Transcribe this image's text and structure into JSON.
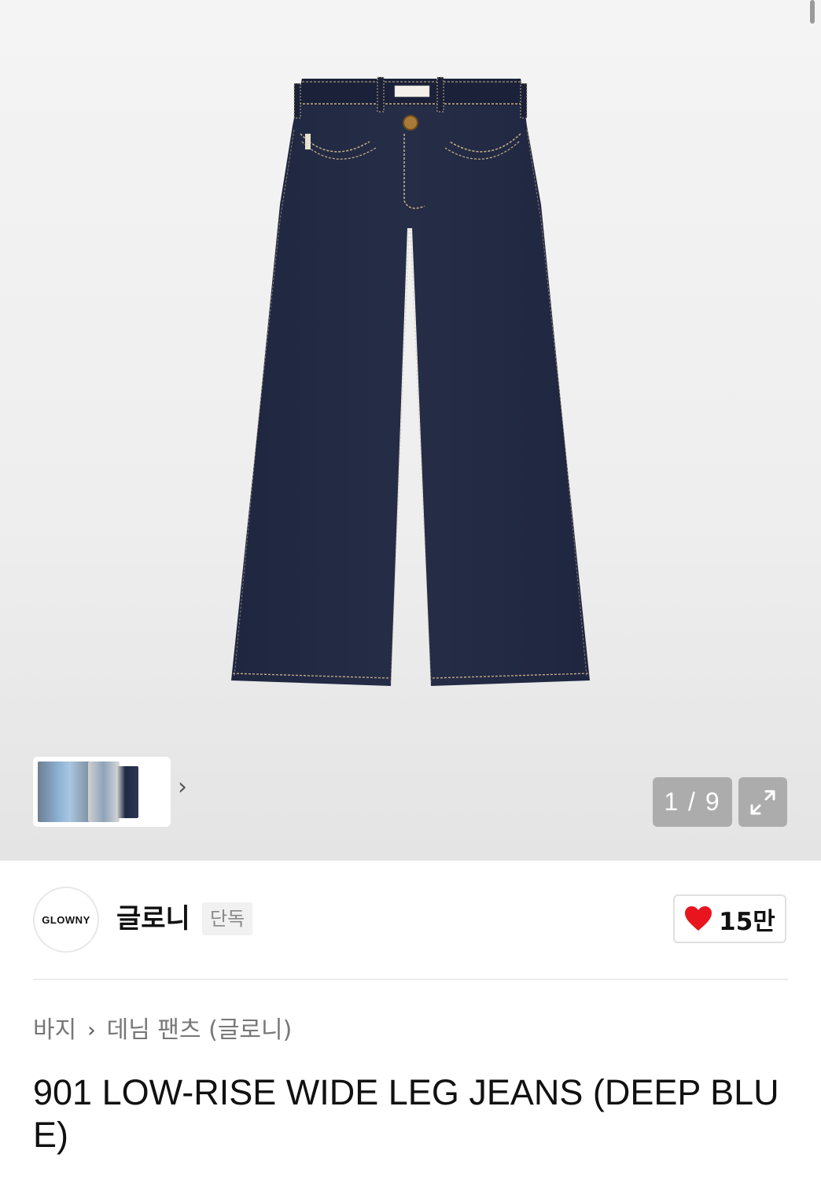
{
  "gallery": {
    "image_alt": "901 LOW-RISE WIDE LEG JEANS (DEEP BLUE) product image",
    "product_color": "#252c44",
    "stitch_color": "#c9b48a",
    "label_text": "GLOWNY",
    "counter": "1 / 9",
    "thumb_arrow": "›",
    "icons": {
      "thumb_arrow": "chevron-right-icon",
      "expand": "expand-arrows-icon"
    }
  },
  "brand": {
    "logo_text": "GLOWNY",
    "name": "글로니",
    "badge": "단독"
  },
  "like": {
    "count": "15만",
    "icon": "heart-icon",
    "color": "#e8151f"
  },
  "breadcrumb": {
    "items": [
      "바지",
      "데님 팬츠 (글로니)"
    ],
    "separator": "›"
  },
  "product": {
    "title": "901 LOW-RISE WIDE LEG JEANS (DEEP BLUE)"
  }
}
